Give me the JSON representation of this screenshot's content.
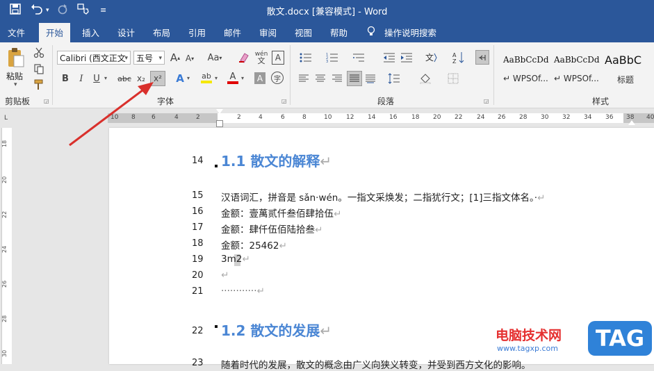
{
  "window": {
    "title": "散文.docx [兼容模式]  -  Word"
  },
  "quick_access": {
    "save_icon": "save-icon",
    "undo_icon": "undo-icon",
    "redo_icon": "redo-icon",
    "touch_icon": "touch-mode-icon",
    "customize_icon": "customize-icon"
  },
  "menu": {
    "tabs": [
      "文件",
      "开始",
      "插入",
      "设计",
      "布局",
      "引用",
      "邮件",
      "审阅",
      "视图",
      "帮助",
      "操作说明搜索"
    ],
    "active": "开始"
  },
  "ribbon": {
    "clipboard": {
      "paste_label": "粘贴",
      "group_label": "剪贴板"
    },
    "font": {
      "font_name": "Calibri (西文正文",
      "font_size": "五号",
      "group_label": "字体",
      "bold": "B",
      "italic": "I",
      "underline": "U",
      "strike": "abc",
      "subscript": "x₂",
      "superscript": "x²",
      "grow": "A",
      "shrink": "A",
      "case": "Aa",
      "text_effect": "A",
      "highlight": "ab",
      "font_color": "A",
      "char_shade": "A",
      "enclose": "字",
      "phonetic": "wén",
      "border": "A"
    },
    "paragraph": {
      "group_label": "段落"
    },
    "styles": {
      "group_label": "样式",
      "cards": [
        {
          "sample": "AaBbCcDd",
          "name": "↵ WPSOf..."
        },
        {
          "sample": "AaBbCcDd",
          "name": "↵ WPSOf..."
        },
        {
          "sample": "AaBbC",
          "name": "标题"
        }
      ]
    }
  },
  "ruler": {
    "numbers": [
      "10",
      "8",
      "6",
      "4",
      "2",
      "2",
      "4",
      "6",
      "8",
      "10",
      "12",
      "14",
      "16",
      "18",
      "20",
      "22",
      "24",
      "26",
      "28",
      "30",
      "32",
      "34",
      "36",
      "38",
      "40"
    ],
    "vertical": [
      "18",
      "20",
      "22",
      "24",
      "26",
      "28",
      "30"
    ]
  },
  "document": {
    "lines": [
      {
        "num": "14",
        "text": "1.1 散文的解释",
        "type": "heading"
      },
      {
        "num": "15",
        "text": "汉语词汇，拼音是 sǎn·wén。一指文采焕发；二指犹行文；[1]三指文体名。·",
        "type": "body"
      },
      {
        "num": "16",
        "text": "金额：壹萬贰仟叁佰肆拾伍",
        "type": "body"
      },
      {
        "num": "17",
        "text": "金额：肆仟伍佰陆拾叁",
        "type": "body"
      },
      {
        "num": "18",
        "text": "金额：25462",
        "type": "body"
      },
      {
        "num": "19",
        "text": "3m2",
        "type": "body"
      },
      {
        "num": "20",
        "text": "",
        "type": "body"
      },
      {
        "num": "21",
        "text": "············",
        "type": "body"
      },
      {
        "num": "22",
        "text": "1.2 散文的发展",
        "type": "heading"
      },
      {
        "num": "23",
        "text": "随着时代的发展，散文的概念由广义向狭义转变，并受到西方文化的影响。",
        "type": "body"
      }
    ],
    "paragraph_mark": "↵"
  },
  "watermark": {
    "text": "电脑技术网",
    "url": "www.tagxp.com",
    "badge": "TAG"
  },
  "colors": {
    "brand": "#2b579a",
    "heading": "#4a86d4",
    "arrow": "#d9302c"
  }
}
